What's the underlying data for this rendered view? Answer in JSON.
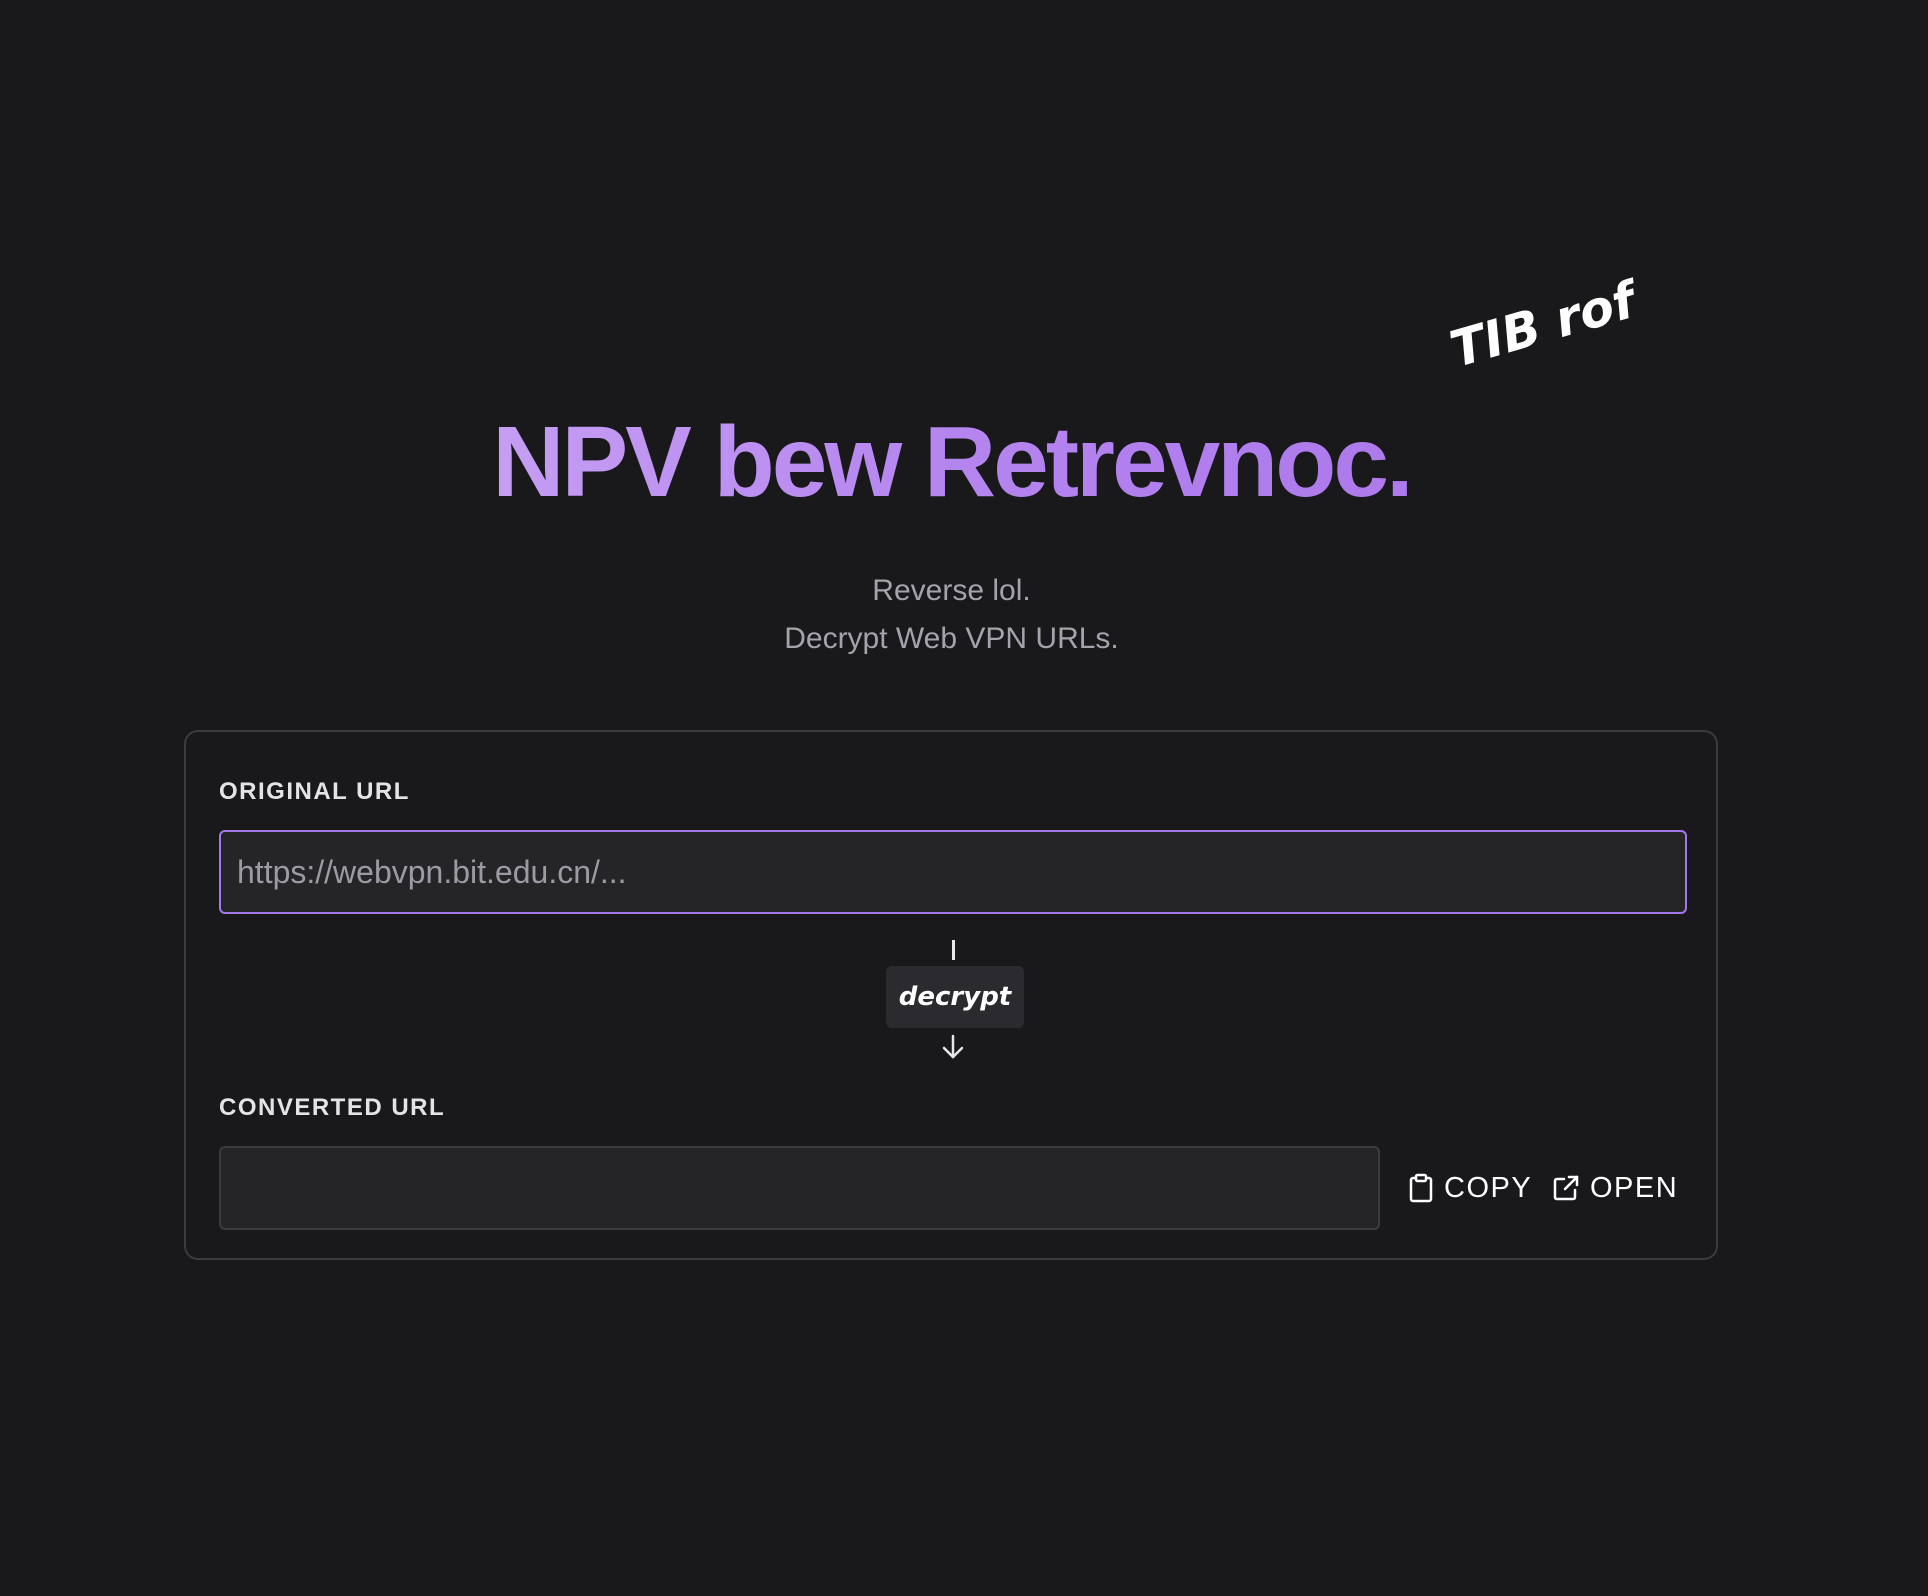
{
  "hero": {
    "title": "NPV bew Retrevnoc.",
    "tag_note": "TIB rof",
    "subtitle_line1": "Reverse lol.",
    "subtitle_line2": "Decrypt Web VPN URLs."
  },
  "form": {
    "original_label": "ORIGINAL URL",
    "original_placeholder": "https://webvpn.bit.edu.cn/...",
    "original_value": "",
    "decrypt_label": "decrypt",
    "converted_label": "CONVERTED URL",
    "converted_value": "",
    "copy_label": "COPY",
    "open_label": "OPEN"
  },
  "icons": {
    "copy": "clipboard-icon",
    "open": "external-link-icon",
    "arrow": "arrow-down-icon"
  },
  "colors": {
    "background": "#19191c",
    "accent": "#a478e8",
    "title_gradient_start": "#d7b8f7",
    "title_gradient_end": "#a56ce8",
    "muted_text": "#a3a3ab",
    "input_bg": "#252528",
    "card_border": "#3b3b40"
  }
}
